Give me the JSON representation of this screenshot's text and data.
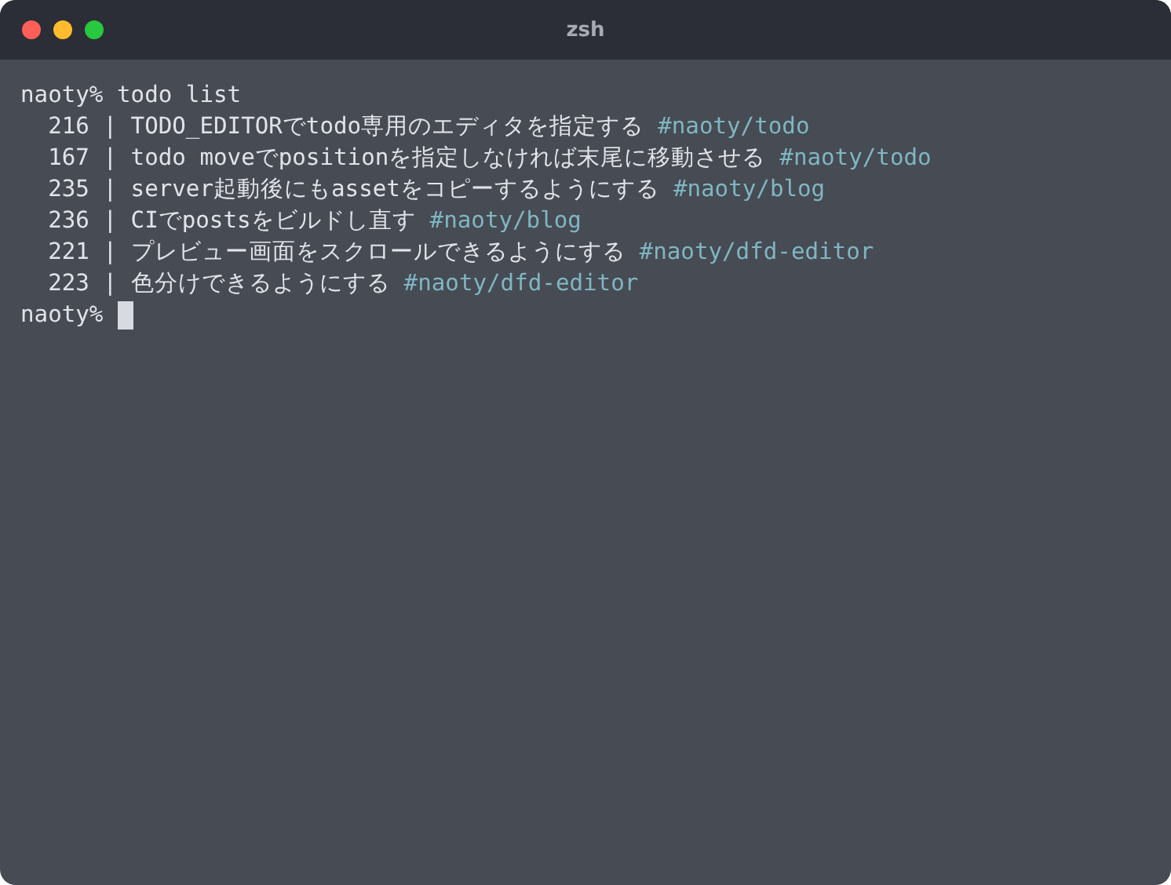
{
  "window": {
    "title": "zsh"
  },
  "terminal": {
    "command_line": "naoty% todo list",
    "rows": [
      {
        "line": "  216 | TODO_EDITORでtodo専用のエディタを指定する",
        "tag": "#naoty/todo"
      },
      {
        "line": "  167 | todo moveでpositionを指定しなければ末尾に移動させる",
        "tag": "#naoty/todo"
      },
      {
        "line": "  235 | server起動後にもassetをコピーするようにする",
        "tag": "#naoty/blog"
      },
      {
        "line": "  236 | CIでpostsをビルドし直す",
        "tag": "#naoty/blog"
      },
      {
        "line": "  221 | プレビュー画面をスクロールできるようにする",
        "tag": "#naoty/dfd-editor"
      },
      {
        "line": "  223 | 色分けできるようにする",
        "tag": "#naoty/dfd-editor"
      }
    ],
    "prompt": "naoty%"
  }
}
